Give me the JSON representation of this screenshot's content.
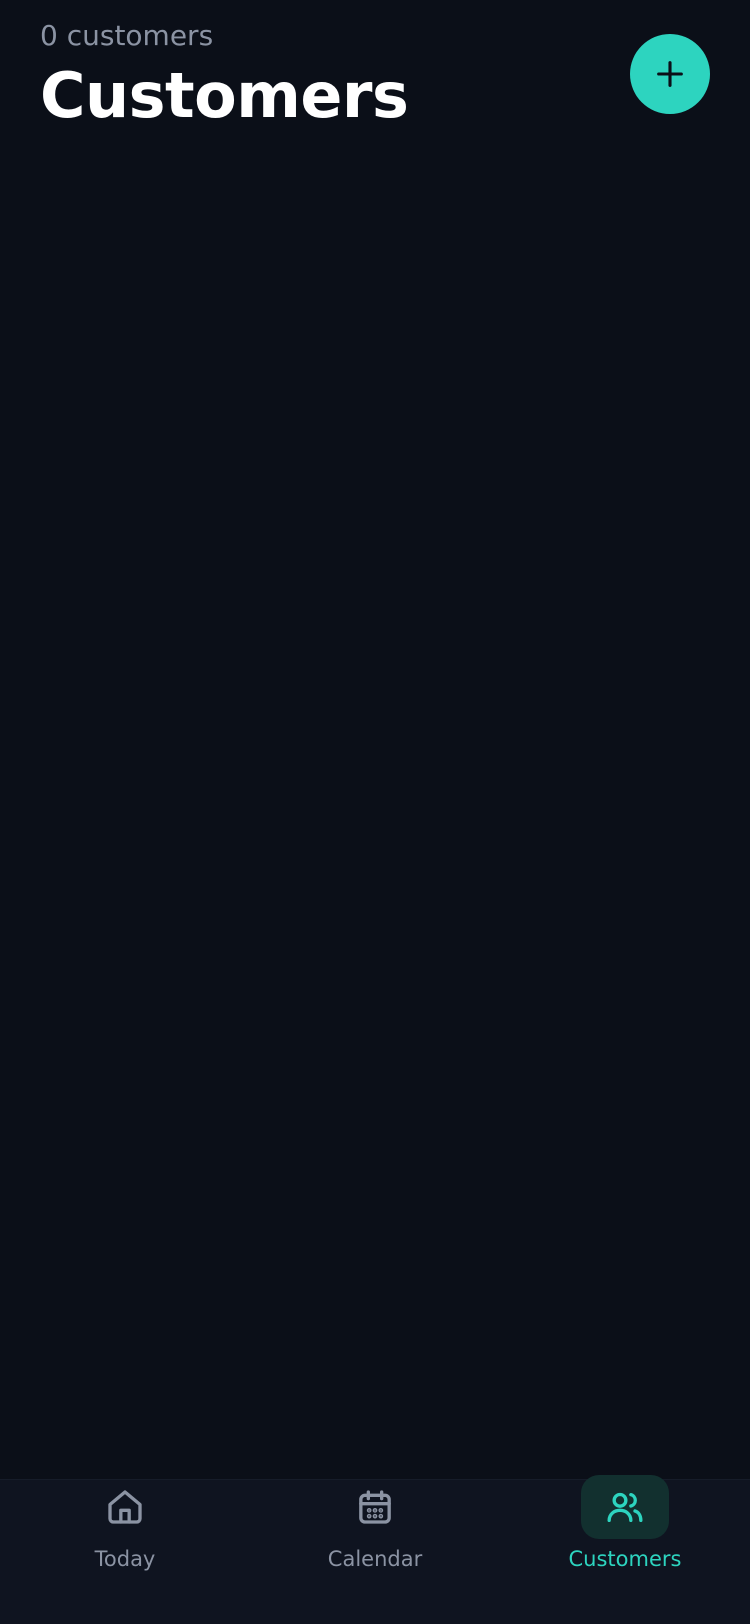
{
  "header": {
    "count_text": "0 customers",
    "title": "Customers"
  },
  "fab": {
    "icon": "plus-icon",
    "color": "#2dd4bf"
  },
  "tabbar": {
    "items": [
      {
        "label": "Today",
        "icon": "home-icon",
        "active": false
      },
      {
        "label": "Calendar",
        "icon": "calendar-icon",
        "active": false
      },
      {
        "label": "Customers",
        "icon": "users-icon",
        "active": true
      }
    ]
  },
  "colors": {
    "background": "#0b0f18",
    "accent": "#2dd4bf",
    "muted": "#8b93a3"
  }
}
